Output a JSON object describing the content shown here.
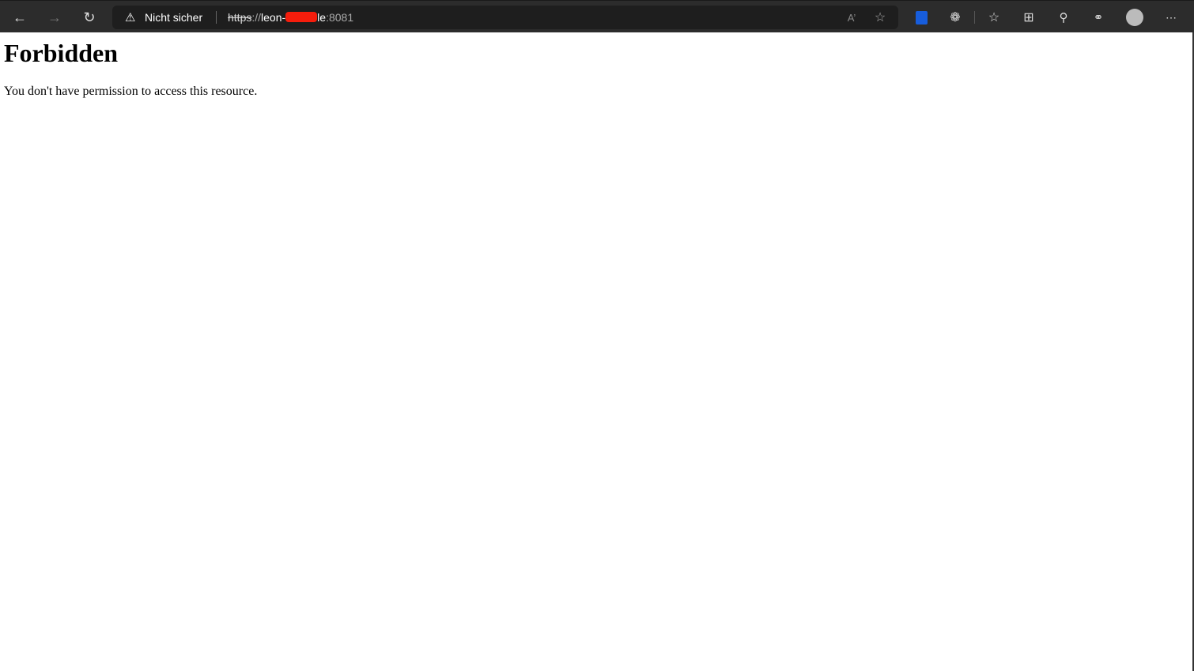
{
  "browser": {
    "security_label": "Nicht sicher",
    "url": {
      "scheme": "https",
      "sep": "://",
      "host_start": "leon-",
      "host_end": "le",
      "port": ":8081"
    },
    "icons": [
      "back-icon",
      "forward-icon",
      "refresh-icon",
      "warning-icon",
      "read-aloud-icon",
      "add-favorite-icon",
      "bitwarden-icon",
      "extensions-icon",
      "favorites-icon",
      "collections-icon",
      "rewards-icon",
      "share-icon",
      "profile-avatar",
      "more-icon"
    ],
    "colors": {
      "toolbar": "#2c2c2c",
      "address_bar": "#1e1e1e",
      "redaction": "#f51d0c"
    }
  },
  "page": {
    "title": "Forbidden",
    "message": "You don't have permission to access this resource."
  }
}
